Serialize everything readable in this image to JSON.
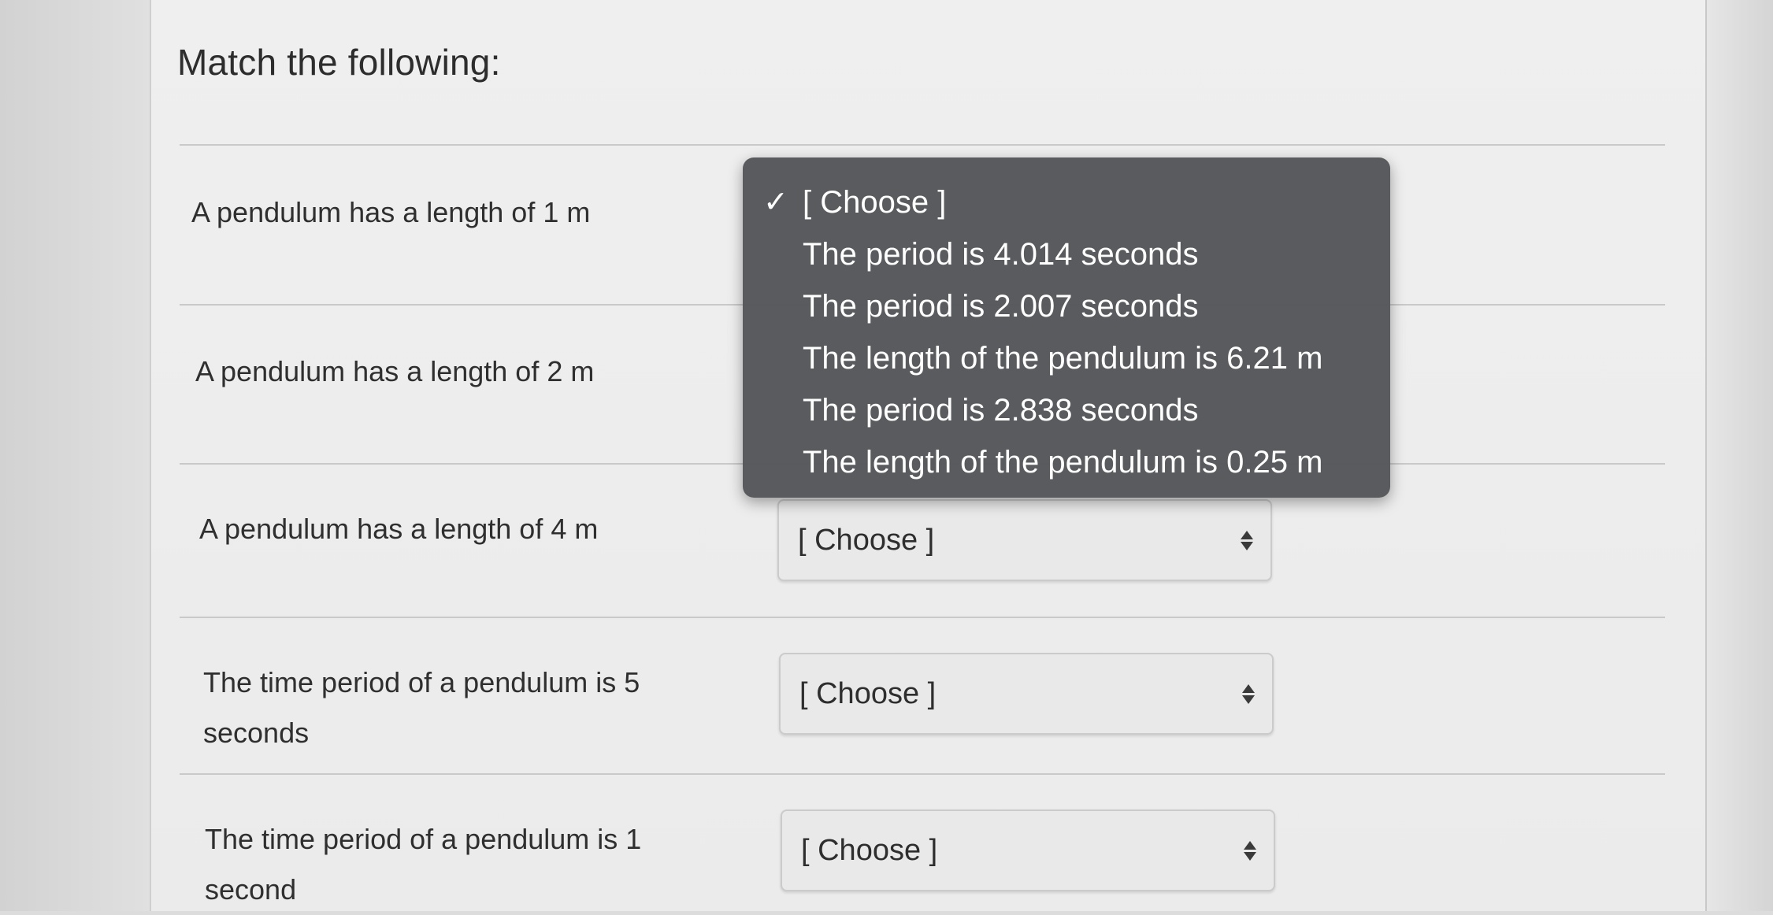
{
  "question": {
    "heading": "Match the following:"
  },
  "rows": [
    {
      "prompt": "A pendulum has a length of 1 m",
      "selected": "[ Choose ]"
    },
    {
      "prompt": "A pendulum has a length of 2 m",
      "selected": "[ Choose ]"
    },
    {
      "prompt": "A pendulum has a length of 4 m",
      "selected": "[ Choose ]"
    },
    {
      "prompt": "The time period of a pendulum is 5 seconds",
      "selected": "[ Choose ]"
    },
    {
      "prompt": "The time period of a pendulum is 1 second",
      "selected": "[ Choose ]"
    }
  ],
  "dropdown": {
    "open_for_row": 1,
    "check_icon": "✓",
    "options": [
      "[ Choose ]",
      "The period is 4.014 seconds",
      "The period is 2.007 seconds",
      "The length of the pendulum is 6.21 m",
      "The period is 2.838 seconds",
      "The length of the pendulum is 0.25 m"
    ]
  }
}
